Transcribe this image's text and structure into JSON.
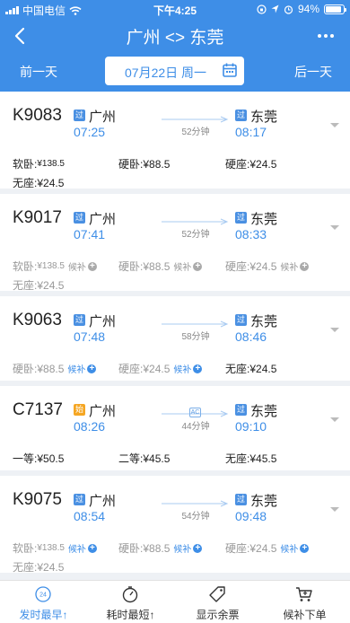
{
  "status_bar": {
    "carrier": "中国电信",
    "time": "下午4:25",
    "battery": "94%"
  },
  "nav": {
    "title": "广州 <> 东莞"
  },
  "date_bar": {
    "prev_label": "前一天",
    "date": "07月22日 周一",
    "next_label": "后一天"
  },
  "colors": {
    "primary": "#3e8ee7",
    "badge_pass": "#4a90e2",
    "badge_start": "#f5a623"
  },
  "trains": [
    {
      "number": "K9083",
      "from_badge": "过",
      "from_station": "广州",
      "depart": "07:25",
      "to_badge": "过",
      "to_station": "东莞",
      "arrive": "08:17",
      "duration": "52分钟",
      "ac_icon": false,
      "seats": [
        {
          "label": "软卧: ",
          "price": "¥138.5",
          "waitlist": "",
          "available": true
        },
        {
          "label": "硬卧: ",
          "price": "¥88.5",
          "waitlist": "",
          "available": true
        },
        {
          "label": "硬座: ",
          "price": "¥24.5",
          "waitlist": "",
          "available": true
        },
        {
          "label": "无座: ",
          "price": "¥24.5",
          "waitlist": "",
          "available": true
        }
      ]
    },
    {
      "number": "K9017",
      "from_badge": "过",
      "from_station": "广州",
      "depart": "07:41",
      "to_badge": "过",
      "to_station": "东莞",
      "arrive": "08:33",
      "duration": "52分钟",
      "ac_icon": false,
      "seats": [
        {
          "label": "软卧: ",
          "price": "¥138.5",
          "waitlist": "候补",
          "available": false
        },
        {
          "label": "硬卧: ",
          "price": "¥88.5",
          "waitlist": "候补",
          "available": false
        },
        {
          "label": "硬座: ",
          "price": "¥24.5",
          "waitlist": "候补",
          "available": false
        },
        {
          "label": "无座: ",
          "price": "¥24.5",
          "waitlist": "",
          "available": false
        }
      ]
    },
    {
      "number": "K9063",
      "from_badge": "过",
      "from_station": "广州",
      "depart": "07:48",
      "to_badge": "过",
      "to_station": "东莞",
      "arrive": "08:46",
      "duration": "58分钟",
      "ac_icon": false,
      "seats": [
        {
          "label": "硬卧: ",
          "price": "¥88.5",
          "waitlist": "候补",
          "available": false
        },
        {
          "label": "硬座: ",
          "price": "¥24.5",
          "waitlist": "候补",
          "available": false
        },
        {
          "label": "无座: ",
          "price": "¥24.5",
          "waitlist": "",
          "available": true
        }
      ]
    },
    {
      "number": "C7137",
      "from_badge": "始",
      "from_station": "广州",
      "depart": "08:26",
      "to_badge": "过",
      "to_station": "东莞",
      "arrive": "09:10",
      "duration": "44分钟",
      "ac_icon": true,
      "seats": [
        {
          "label": "一等: ",
          "price": "¥50.5",
          "waitlist": "",
          "available": true
        },
        {
          "label": "二等: ",
          "price": "¥45.5",
          "waitlist": "",
          "available": true
        },
        {
          "label": "无座: ",
          "price": "¥45.5",
          "waitlist": "",
          "available": true
        }
      ]
    },
    {
      "number": "K9075",
      "from_badge": "过",
      "from_station": "广州",
      "depart": "08:54",
      "to_badge": "过",
      "to_station": "东莞",
      "arrive": "09:48",
      "duration": "54分钟",
      "ac_icon": false,
      "seats": [
        {
          "label": "软卧: ",
          "price": "¥138.5",
          "waitlist": "候补",
          "available": false
        },
        {
          "label": "硬卧: ",
          "price": "¥88.5",
          "waitlist": "候补",
          "available": false
        },
        {
          "label": "硬座: ",
          "price": "¥24.5",
          "waitlist": "候补",
          "available": false
        },
        {
          "label": "无座: ",
          "price": "¥24.5",
          "waitlist": "",
          "available": false
        }
      ]
    }
  ],
  "tab_bar": {
    "tabs": [
      {
        "label": "发时最早↑",
        "icon": "clock-24-icon",
        "icon_text": "24",
        "active": true
      },
      {
        "label": "耗时最短↑",
        "icon": "stopwatch-icon",
        "active": false
      },
      {
        "label": "显示余票",
        "icon": "ticket-tag-icon",
        "active": false
      },
      {
        "label": "候补下单",
        "icon": "cart-plus-icon",
        "active": false
      }
    ]
  }
}
